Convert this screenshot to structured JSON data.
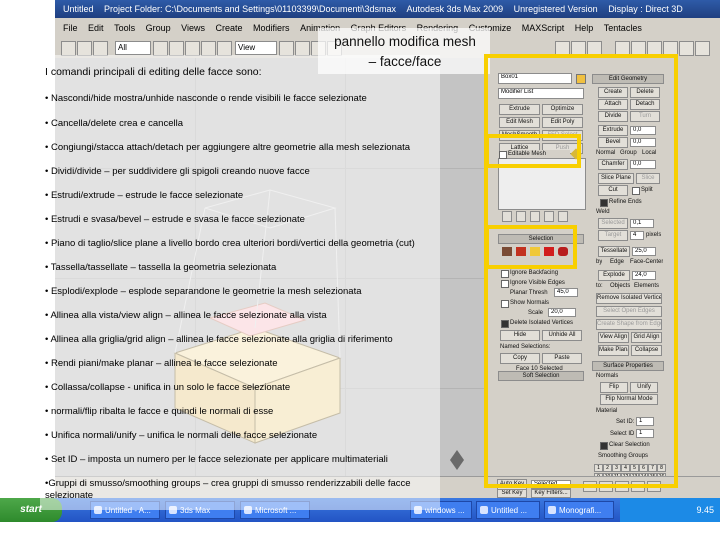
{
  "colors": {
    "highlight": "#f8cf00",
    "titlebar": "#2e5ba8",
    "panel": "#d4d0c8",
    "viewport": "#c4c4c4",
    "taskbar": "#2354c4"
  },
  "app": {
    "title_items": [
      "Untitled",
      "Project Folder: C:\\Documents and Settings\\01103399\\Documenti\\3dsmax",
      "Autodesk 3ds Max 2009",
      "Unregistered Version",
      "Display : Direct 3D"
    ],
    "menu_items": [
      "File",
      "Edit",
      "Tools",
      "Group",
      "Views",
      "Create",
      "Modifiers",
      "Animation",
      "Graph Editors",
      "Rendering",
      "Customize",
      "MAXScript",
      "Help",
      "Tentacles"
    ],
    "toolbar": {
      "selection_filter": "All",
      "reference_coord": "View"
    },
    "start_label": "start",
    "taskbar_items": [
      "Untitled - A...",
      "3ds Max",
      "Microsoft ...",
      "windows ...",
      "Untitled ...",
      "Monografi..."
    ],
    "clock": "9.45"
  },
  "panel": {
    "object_name": "Box01",
    "modifier_list": "Modifier List",
    "stack_item": "Editable Mesh",
    "edit_geometry": {
      "header": "Edit Geometry",
      "create": "Create",
      "delete": "Delete",
      "attach": "Attach",
      "detach": "Detach",
      "divide": "Divide",
      "turn": "Turn",
      "extrude": "Extrude",
      "extrude_val": "0,0",
      "bevel": "Bevel",
      "bevel_val": "0,0",
      "normal": "Normal",
      "group": "Group",
      "local": "Local",
      "chamfer": "Chamfer",
      "chamfer_val": "0,0",
      "slice_plane": "Slice Plane",
      "slice": "Slice",
      "cut": "Cut",
      "split": "Split",
      "refine_ends": "Refine Ends",
      "weld": "Weld",
      "selected": "Selected",
      "selected_val": "0,1",
      "target": "Target",
      "target_val": "4",
      "pixels": "pixels",
      "tessellate": "Tessellate",
      "tessellate_val": "25,0",
      "by": "by",
      "edge": "Edge",
      "face_center": "Face-Center",
      "explode": "Explode",
      "explode_val": "24,0",
      "to": "to:",
      "objects": "Objects",
      "elements": "Elements",
      "remove_isolated": "Remove Isolated Vertices",
      "select_open_edges": "Select Open Edges",
      "create_shape": "Create Shape from Edges",
      "view_align": "View Align",
      "grid_align": "Grid Align",
      "make_planar": "Make Planar",
      "collapse": "Collapse"
    },
    "col1": {
      "extrude": "Extrude",
      "optimize": "Optimize",
      "edit_mesh": "Edit Mesh",
      "edit_poly": "Edit Poly",
      "meshsmooth": "MeshSmooth",
      "ffd_select": "FFD Select",
      "lattice": "Lattice",
      "push": "Push"
    },
    "selection": {
      "header": "Selection",
      "ignore_backfacing": "Ignore Backfacing",
      "ignore_visible_edges": "Ignore Visible Edges",
      "planar_thresh": "Planar Thresh",
      "planar_val": "45,0",
      "show_normals": "Show Normals",
      "scale": "Scale",
      "scale_val": "20,0",
      "delete_isolated": "Delete Isolated Vertices",
      "hide": "Hide",
      "unhide_all": "Unhide All",
      "named_selections": "Named Selections:",
      "copy": "Copy",
      "paste": "Paste",
      "faces_selected": "Face 10 Selected"
    },
    "soft_selection": "Soft Selection",
    "surface_properties": {
      "header": "Surface Properties",
      "normals": "Normals",
      "flip": "Flip",
      "unify": "Unify",
      "flip_normal_mode": "Flip Normal Mode",
      "material": "Material",
      "set_id": "Set ID:",
      "set_id_val": "1",
      "select_id": "Select ID",
      "select_id_val": "1",
      "clear_selection": "Clear Selection",
      "smoothing_groups": "Smoothing Groups",
      "groups": [
        "1",
        "2",
        "3",
        "4",
        "5",
        "6",
        "7",
        "8",
        "9",
        "10",
        "11",
        "12",
        "13",
        "14",
        "15",
        "16",
        "17",
        "18",
        "19",
        "20",
        "21",
        "22",
        "23",
        "24",
        "25",
        "26",
        "27",
        "28",
        "29",
        "30",
        "31",
        "32"
      ]
    }
  },
  "status": {
    "autokey": "Auto Key",
    "selected": "Selected",
    "set_key": "Set Key",
    "key_filters": "Key Filters..."
  },
  "slide": {
    "title": "pannello modifica mesh – facce/face",
    "intro": "I comandi  principali di editing delle facce sono:",
    "bullets": [
      "• Nascondi/hide mostra/unhide nasconde o rende visibili le facce selezionate",
      "• Cancella/delete crea e cancella",
      "• Congiungi/stacca attach/detach per aggiungere altre geometrie alla mesh selezionata",
      "• Dividi/divide – per suddividere gli spigoli creando nuove facce",
      "• Estrudi/extrude – estrude le facce selezionate",
      "• Estrudi e svasa/bevel – estrude e svasa le facce selezionate",
      "• Piano di taglio/slice plane a livello bordo crea ulteriori bordi/vertici della geometria (cut)",
      "• Tassella/tassellate – tassella la geometria selezionata",
      "• Esplodi/explode – esplode separandone le geometrie la mesh selezionata",
      "• Allinea alla vista/view align – allinea le facce selezionate alla vista",
      "• Allinea alla griglia/grid align – allinea le facce selezionate alla griglia di riferimento",
      "• Rendi piani/make planar – allinea le facce selezionate",
      "• Collassa/collapse  - unifica in un solo le facce selezionate",
      "• normali/flip ribalta le facce e quindi le normali di esse",
      "• Unifica normali/unify – unifica le normali delle facce selezionate",
      "• Set ID – imposta un numero per le facce selezionate per applicare multimateriali",
      "•Gruppi di smusso/smoothing groups – crea gruppi di smusso renderizzabili delle facce selezionate"
    ]
  }
}
